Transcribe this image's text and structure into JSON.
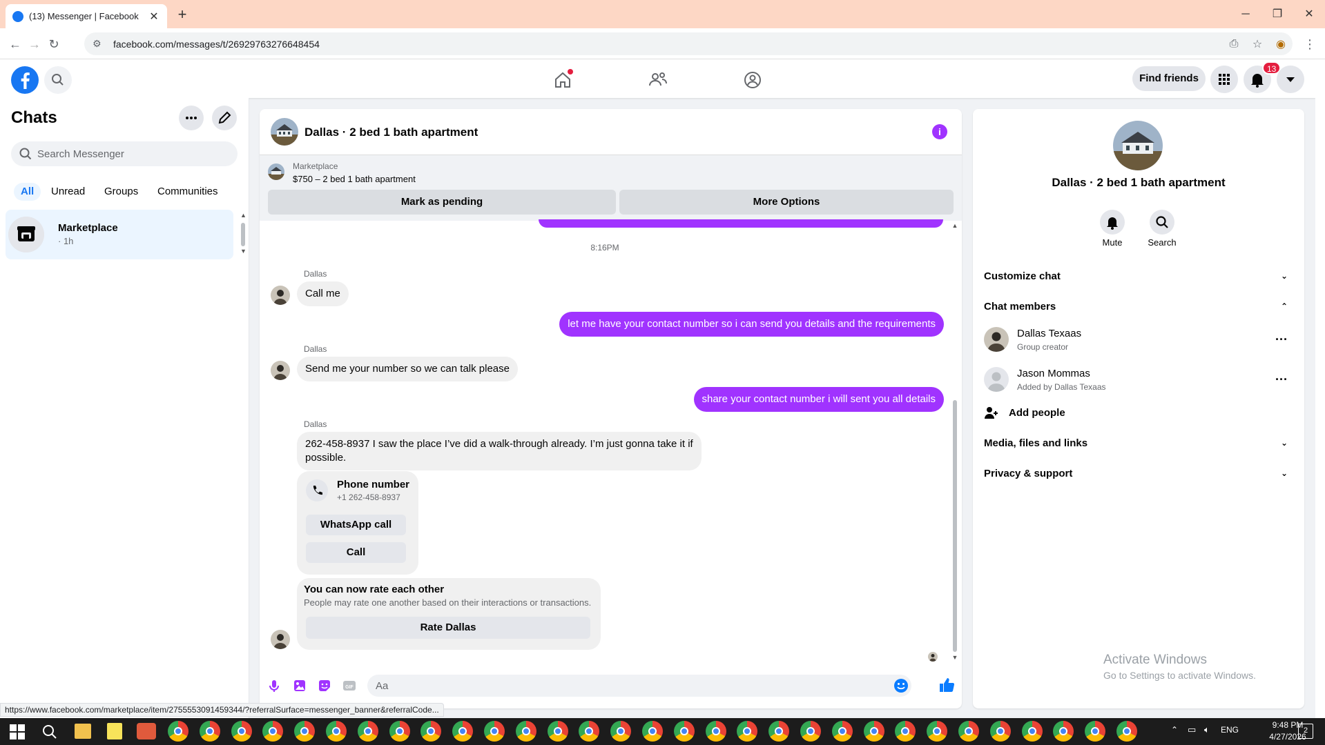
{
  "browser": {
    "tab_title": "(13) Messenger | Facebook",
    "url": "facebook.com/messages/t/26929763276648454",
    "status_url": "https://www.facebook.com/marketplace/item/2755553091459344/?referralSurface=messenger_banner&referralCode..."
  },
  "fbnav": {
    "find_friends": "Find friends",
    "notification_count": "13"
  },
  "left": {
    "title": "Chats",
    "search_placeholder": "Search Messenger",
    "filters": [
      "All",
      "Unread",
      "Groups",
      "Communities"
    ],
    "active_filter": "All",
    "conversation": {
      "name": "Marketplace",
      "time": "· 1h"
    }
  },
  "chat": {
    "title": "Dallas · 2 bed 1 bath apartment",
    "banner": {
      "label": "Marketplace",
      "price_title": "$750 – 2 bed 1 bath apartment",
      "btn_pending": "Mark as pending",
      "btn_more": "More Options"
    },
    "timestamp": "8:16PM",
    "messages": [
      {
        "sender": "Dallas",
        "text": "Call me"
      },
      {
        "out": "let me have your contact number so i can send you details and the requirements"
      },
      {
        "sender": "Dallas",
        "text": "Send me your number so we can talk please"
      },
      {
        "out": "share your contact number i will sent you all details"
      },
      {
        "sender": "Dallas",
        "text": "262-458-8937 I saw the place I’ve did a walk-through already. I’m just gonna take it if possible."
      }
    ],
    "phone_card": {
      "title": "Phone number",
      "number": "+1 262-458-8937",
      "btn_whatsapp": "WhatsApp call",
      "btn_call": "Call"
    },
    "rate_card": {
      "title": "You can now rate each other",
      "desc": "People may rate one another based on their interactions or transactions.",
      "btn": "Rate Dallas"
    },
    "composer_placeholder": "Aa"
  },
  "info": {
    "title": "Dallas · 2 bed 1 bath apartment",
    "actions": [
      "Mute",
      "Search"
    ],
    "sections": {
      "customize": "Customize chat",
      "members": "Chat members",
      "media": "Media, files and links",
      "privacy": "Privacy & support"
    },
    "members": [
      {
        "name": "Dallas Texaas",
        "sub": "Group creator"
      },
      {
        "name": "Jason Mommas",
        "sub": "Added by Dallas Texaas"
      }
    ],
    "add_people": "Add people"
  },
  "watermark": {
    "line1": "Activate Windows",
    "line2": "Go to Settings to activate Windows."
  },
  "taskbar": {
    "lang": "ENG",
    "time": "9:48 PM",
    "date": "4/27/2026"
  },
  "colors": {
    "accent_purple": "#a033ff",
    "fb_blue": "#1877f2",
    "badge_red": "#e41e3f"
  }
}
